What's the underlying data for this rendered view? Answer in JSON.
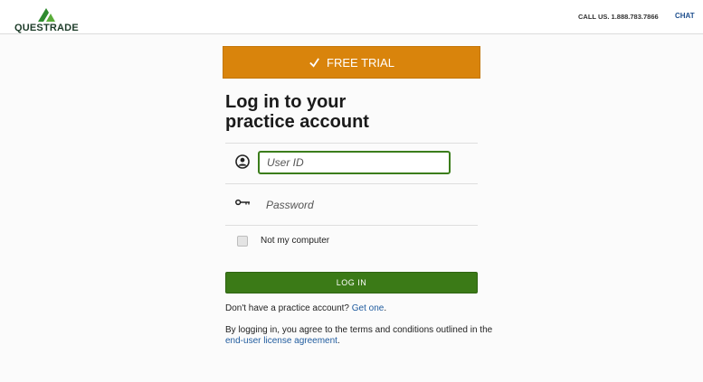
{
  "header": {
    "logo_text": "QUESTRADE",
    "call_label": "CALL US. 1.888.783.7866",
    "chat_label": "CHAT"
  },
  "trial": {
    "label": "FREE TRIAL",
    "icon": "checkmark-icon"
  },
  "login": {
    "title_line1": "Log in to your",
    "title_line2": "practice account",
    "user_id_placeholder": "User ID",
    "password_placeholder": "Password",
    "user_icon": "user-circle-icon",
    "password_icon": "key-icon",
    "remember_label": "Not my computer",
    "submit_label": "LOG IN"
  },
  "footer": {
    "no_account_text": "Don't have a practice account?",
    "get_one_link": "Get one",
    "period": ".",
    "terms_text": "By logging in, you agree to the terms and conditions outlined in the",
    "eula_link": "end-user license agreement",
    "eula_period": "."
  },
  "colors": {
    "trial_bg": "#d9840c",
    "login_btn_bg": "#3b7a17",
    "input_focus_border": "#3b7d1b",
    "link": "#1f5b9e"
  }
}
